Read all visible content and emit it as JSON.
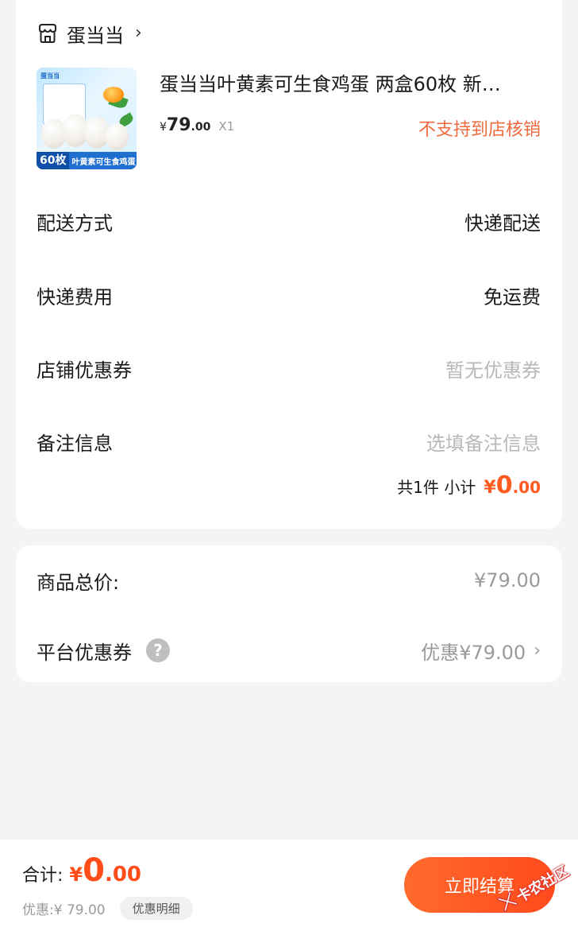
{
  "shop": {
    "name": "蛋当当",
    "product": {
      "title": "蛋当当叶黄素可生食鸡蛋 两盒60枚 新…",
      "price_yen": "¥",
      "price_int": "79",
      "price_dec": ".00",
      "quantity": "X1",
      "store_note": "不支持到店核销",
      "image_logo": "蛋当当",
      "image_badge": "60枚",
      "image_band_text": "叶黄素可生食鸡蛋"
    },
    "rows": {
      "delivery_label": "配送方式",
      "delivery_value": "快递配送",
      "shipping_fee_label": "快递费用",
      "shipping_fee_value": "免运费",
      "store_coupon_label": "店铺优惠券",
      "store_coupon_value": "暂无优惠券",
      "remark_label": "备注信息",
      "remark_placeholder": "选填备注信息"
    },
    "subtotal": {
      "text": "共1件 小计",
      "yen": "¥",
      "int": "0",
      "dec": ".00"
    }
  },
  "summary": {
    "goods_total_label": "商品总价:",
    "goods_total_value": "¥79.00",
    "platform_coupon_label": "平台优惠券",
    "platform_coupon_help": "?",
    "platform_coupon_value": "优惠¥79.00"
  },
  "bottom_bar": {
    "total_label": "合计:",
    "total_yen": "¥",
    "total_int": "0",
    "total_dec": ".00",
    "discount_text": "优惠:¥ 79.00",
    "discount_detail_label": "优惠明细",
    "checkout_label": "立即结算"
  },
  "watermark": {
    "text": "卡农社区"
  },
  "colors": {
    "accent": "#ff5a1f",
    "store_note": "#f06a3c",
    "muted": "#9a9a9a",
    "background": "#f4f4f4"
  },
  "icons": {
    "shop": "store-icon",
    "chevron": "chevron-right-icon",
    "help": "question-circle-icon"
  }
}
